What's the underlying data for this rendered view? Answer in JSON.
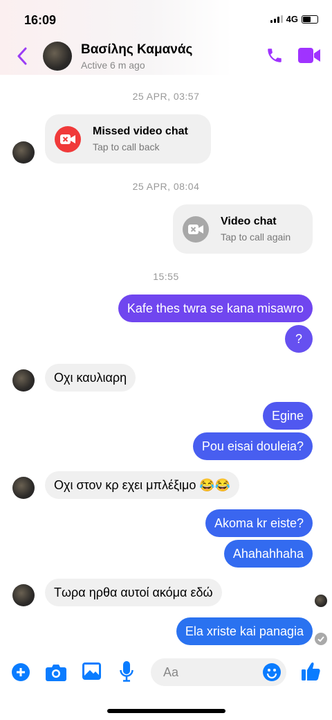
{
  "status_bar": {
    "time": "16:09",
    "network": "4G"
  },
  "header": {
    "name": "Βασίλης Καμανάς",
    "status": "Active 6 m ago"
  },
  "messages": {
    "ts1": "25 APR, 03:57",
    "missed_title": "Missed video chat",
    "missed_sub": "Tap to call back",
    "ts2": "25 APR, 08:04",
    "video_title": "Video chat",
    "video_sub": "Tap to call again",
    "ts3": "15:55",
    "m1": "Kafe thes twra se kana misawro",
    "m2": "?",
    "m3": "Οχι καυλιαρη",
    "m4": "Egine",
    "m5": "Pou eisai douleia?",
    "m6": "Οχι στον κρ εχει μπλέξιμο 😂😂",
    "m7": "Akoma kr eiste?",
    "m8": "Ahahahhaha",
    "m9": "Τωρα ηρθα αυτοί ακόμα εδώ",
    "m10": "Ela xriste kai panagia"
  },
  "composer": {
    "placeholder": "Aa"
  },
  "colors": {
    "accent": "#a033ff",
    "blue": "#0a7cff",
    "missed": "#f03a3a"
  }
}
